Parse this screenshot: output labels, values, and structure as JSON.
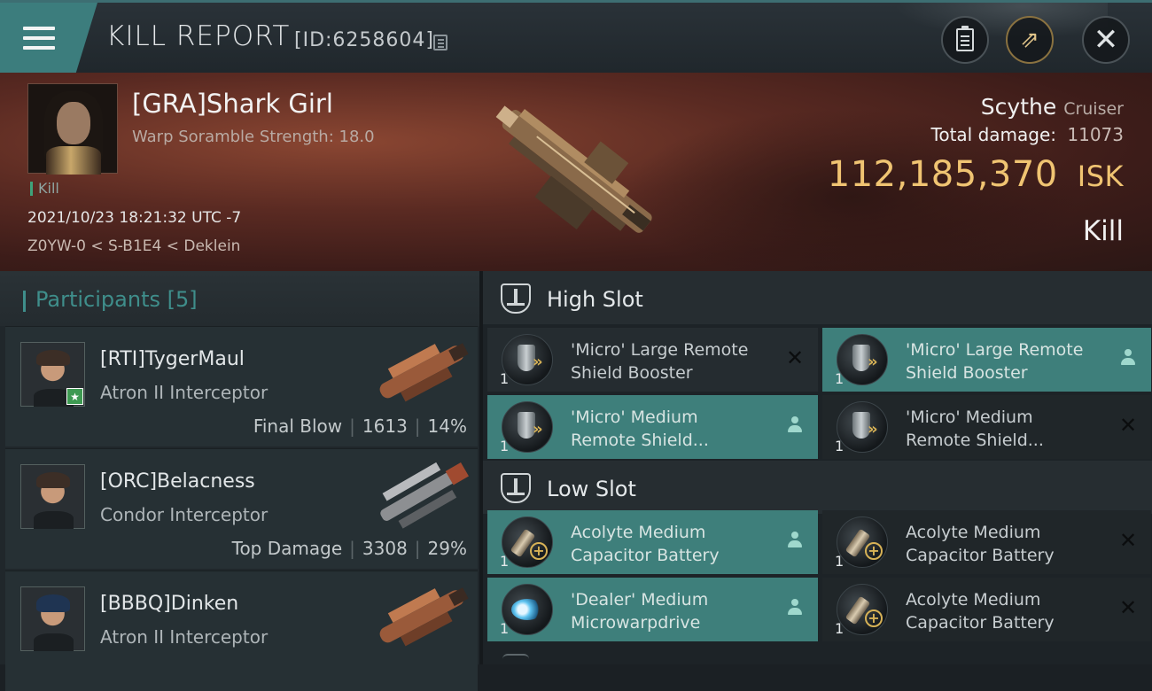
{
  "header": {
    "title": "KILL REPORT",
    "report_id": "[ID:6258604]",
    "icons": [
      "menu-icon",
      "copy-icon",
      "clipboard-icon",
      "share-icon",
      "close-icon"
    ]
  },
  "victim": {
    "name": "[GRA]Shark Girl",
    "warp_info": "Warp Soramble Strength: 18.0",
    "tag": "Kill",
    "datetime": "2021/10/23 18:21:32 UTC -7",
    "location": "Z0YW-0 < S-B1E4 < Deklein",
    "ship_name": "Scythe",
    "ship_class": "Cruiser",
    "total_damage_label": "Total damage:",
    "total_damage": "11073",
    "isk_value": "112,185,370",
    "isk_unit": "ISK",
    "result": "Kill"
  },
  "participants": {
    "title": "Participants",
    "count": "[5]",
    "rows": [
      {
        "name": "[RTI]TygerMaul",
        "ship": "Atron II Interceptor",
        "label": "Final Blow",
        "damage": "1613",
        "percent": "14%"
      },
      {
        "name": "[ORC]Belacness",
        "ship": "Condor Interceptor",
        "label": "Top Damage",
        "damage": "3308",
        "percent": "29%"
      },
      {
        "name": "[BBBQ]Dinken",
        "ship": "Atron II Interceptor"
      }
    ]
  },
  "fitting": {
    "high_slot_title": "High Slot",
    "low_slot_title": "Low Slot",
    "high": [
      {
        "qty": "1",
        "line1": "'Micro' Large Remote",
        "line2": "Shield Booster",
        "status": "✕"
      },
      {
        "qty": "1",
        "line1": "'Micro' Large Remote",
        "line2": "Shield Booster",
        "status": "person"
      },
      {
        "qty": "1",
        "line1": "'Micro' Medium",
        "line2": "Remote Shield...",
        "status": "person"
      },
      {
        "qty": "1",
        "line1": "'Micro' Medium",
        "line2": "Remote Shield...",
        "status": "✕"
      }
    ],
    "low": [
      {
        "qty": "1",
        "line1": "Acolyte Medium",
        "line2": "Capacitor Battery",
        "status": "person"
      },
      {
        "qty": "1",
        "line1": "Acolyte Medium",
        "line2": "Capacitor Battery",
        "status": "✕"
      },
      {
        "qty": "1",
        "line1": "'Dealer' Medium",
        "line2": "Microwarpdrive",
        "status": "person"
      },
      {
        "qty": "1",
        "line1": "Acolyte Medium",
        "line2": "Capacitor Battery",
        "status": "✕"
      }
    ]
  },
  "colors": {
    "accent_teal": "#3e7f7b",
    "isk_gold": "#f0c472",
    "banner_red": "#5a2a22"
  }
}
